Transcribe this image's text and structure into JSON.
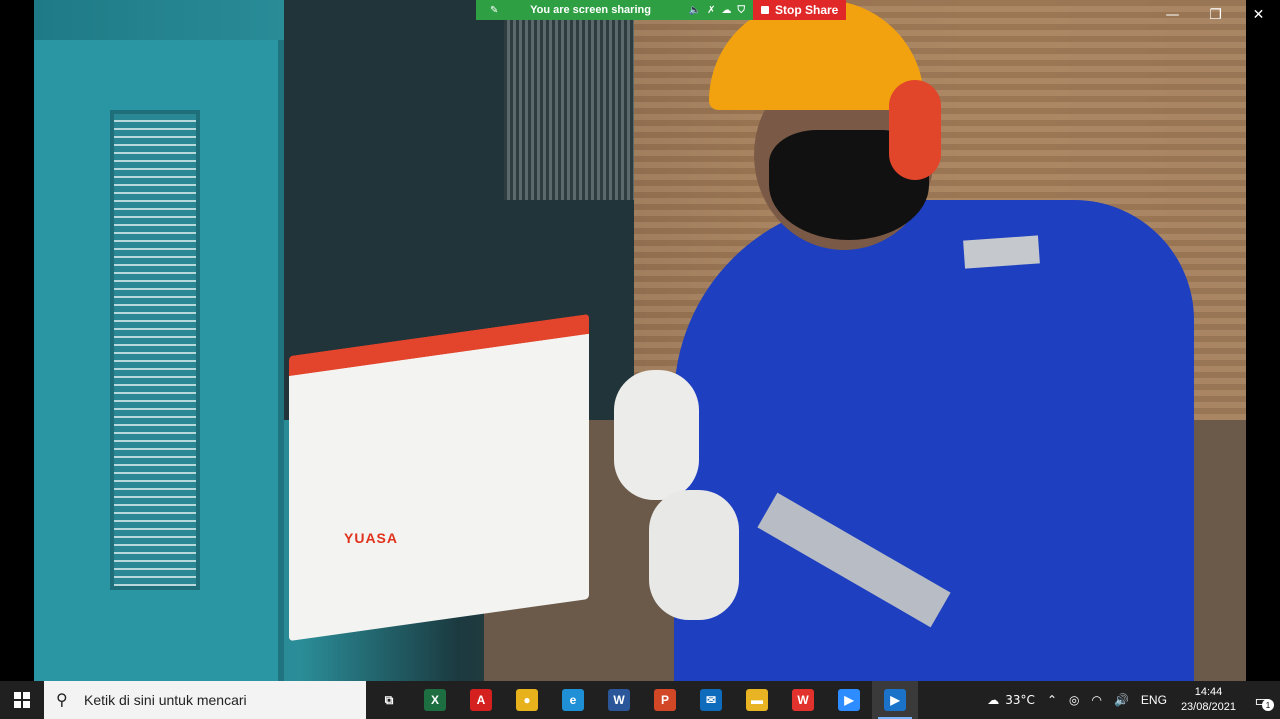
{
  "share_banner": {
    "status_text": "You are screen sharing",
    "stop_label": "Stop Share"
  },
  "window_controls": {
    "minimize": "—",
    "restore": "❐",
    "close": "✕"
  },
  "video": {
    "battery_brand": "YUASA"
  },
  "taskbar": {
    "search_placeholder": "Ketik di sini untuk mencari",
    "apps": [
      {
        "name": "task-view",
        "glyph": "⧉",
        "color": "#202020"
      },
      {
        "name": "excel",
        "glyph": "X",
        "color": "#1d6f42"
      },
      {
        "name": "acrobat",
        "glyph": "A",
        "color": "#d4201f"
      },
      {
        "name": "chrome",
        "glyph": "●",
        "color": "#e8b21c"
      },
      {
        "name": "edge",
        "glyph": "e",
        "color": "#1f8fd6"
      },
      {
        "name": "word",
        "glyph": "W",
        "color": "#2b579a"
      },
      {
        "name": "powerpoint",
        "glyph": "P",
        "color": "#d24726"
      },
      {
        "name": "mail",
        "glyph": "✉",
        "color": "#0f6cbd"
      },
      {
        "name": "file-explorer",
        "glyph": "▬",
        "color": "#e8b423"
      },
      {
        "name": "wps",
        "glyph": "W",
        "color": "#e2322d"
      },
      {
        "name": "zoom",
        "glyph": "▶",
        "color": "#2d8cff"
      },
      {
        "name": "zoom-share",
        "glyph": "▶",
        "color": "#1a73c9"
      }
    ],
    "weather": "33°C",
    "language": "ENG",
    "time": "14:44",
    "date": "23/08/2021",
    "notification_count": "1"
  }
}
